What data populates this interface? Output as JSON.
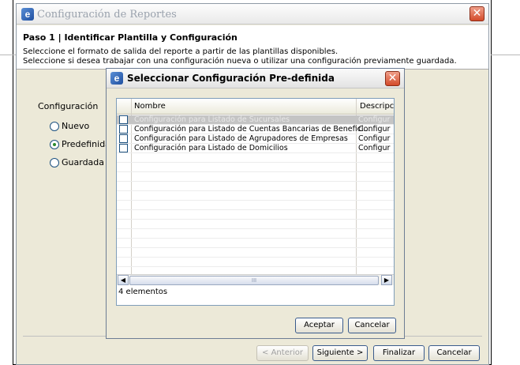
{
  "main_window": {
    "title": "Configuración de Reportes",
    "step_title": "Paso 1 | Identificar Plantilla y Configuración",
    "description_line1": "Seleccione el formato de salida del reporte a partir de las plantillas disponibles.",
    "description_line2": "Seleccione si desea trabajar con una configuración nueva o utilizar una configuración previamente guardada.",
    "config_label": "Configuración",
    "radio_options": [
      {
        "label": "Nuevo",
        "checked": false
      },
      {
        "label": "Predefinida",
        "checked": true
      },
      {
        "label": "Guardada",
        "checked": false
      }
    ],
    "buttons": {
      "back": "< Anterior",
      "next": "Siguiente >",
      "finish": "Finalizar",
      "cancel": "Cancelar"
    }
  },
  "dialog": {
    "title": "Seleccionar Configuración Pre-definida",
    "columns": [
      "Nombre",
      "Descripc"
    ],
    "rows": [
      {
        "name": "Configuración para Listado de Sucursales",
        "desc": "Configur",
        "selected": true
      },
      {
        "name": "Configuración para Listado de Cuentas Bancarias de Benefici...",
        "desc": "Configur",
        "selected": false
      },
      {
        "name": "Configuración para Listado de Agrupadores de Empresas",
        "desc": "Configur",
        "selected": false
      },
      {
        "name": "Configuración para Listado de Domicilios",
        "desc": "Configur",
        "selected": false
      }
    ],
    "count_label": "4 elementos",
    "scroll_grip": "III",
    "buttons": {
      "accept": "Aceptar",
      "cancel": "Cancelar"
    }
  },
  "icons": {
    "app": "app-logo-icon",
    "close": "close-icon",
    "scroll_left": "scroll-left-arrow-icon",
    "scroll_right": "scroll-right-arrow-icon"
  }
}
